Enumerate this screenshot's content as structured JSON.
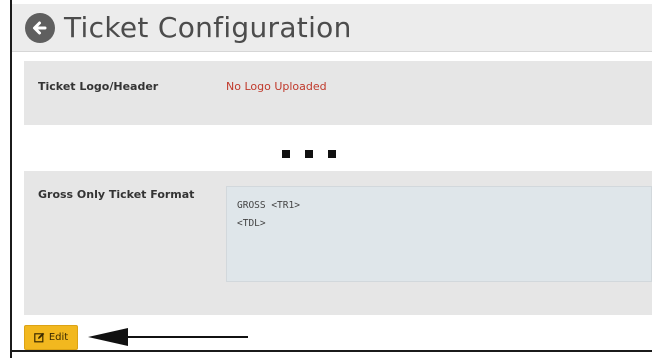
{
  "header": {
    "title": "Ticket Configuration",
    "back_icon": "arrow-left-circle-icon"
  },
  "logo_section": {
    "label": "Ticket Logo/Header",
    "status": "No Logo Uploaded",
    "status_color": "#c0392b"
  },
  "gross_section": {
    "label": "Gross Only Ticket Format",
    "format_lines": [
      "GROSS <TR1>",
      "<TDL>"
    ]
  },
  "edit_button": {
    "icon": "edit-icon",
    "label": "Edit",
    "color": "#f2b81f"
  },
  "annotation": {
    "icon": "arrow-left-icon"
  }
}
